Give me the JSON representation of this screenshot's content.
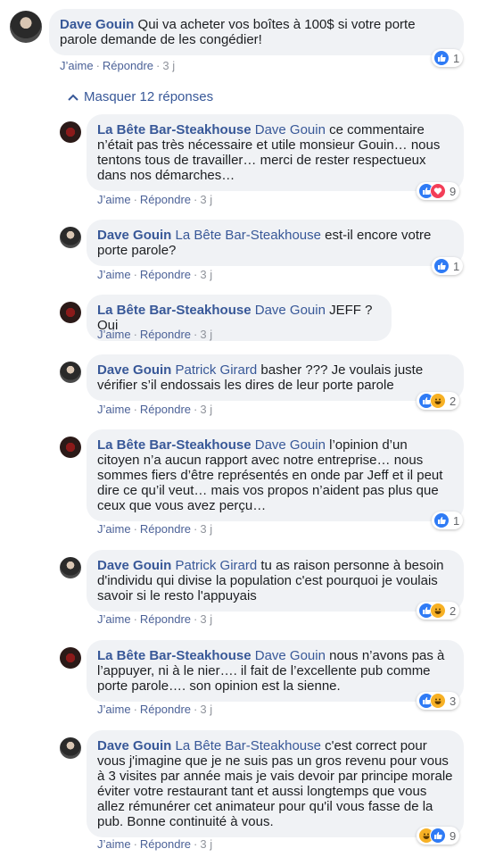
{
  "actions": {
    "like": "J’aime",
    "reply": "Répondre",
    "sep": "·"
  },
  "toggle": {
    "label": "Masquer 12 réponses"
  },
  "comments": [
    {
      "author": "Dave Gouin",
      "tag": "",
      "text": "Qui va acheter vos boîtes à 100$ si votre porte parole demande de les congédier!",
      "time": "3 j",
      "reactions": [
        "like"
      ],
      "count": "1"
    },
    {
      "author": "La Bête Bar-Steakhouse",
      "tag": "Dave Gouin",
      "text": "ce commentaire n’était pas très nécessaire et utile monsieur Gouin… nous tentons tous de travailler… merci de rester respectueux dans nos démarches…",
      "time": "3 j",
      "reactions": [
        "like",
        "love"
      ],
      "count": "9"
    },
    {
      "author": "Dave Gouin",
      "tag": "La Bête Bar-Steakhouse",
      "text": "est-il encore votre porte parole?",
      "time": "3 j",
      "reactions": [
        "like"
      ],
      "count": "1"
    },
    {
      "author": "La Bête Bar-Steakhouse",
      "tag": "Dave Gouin",
      "text": "JEFF ? Oui",
      "time": "3 j",
      "reactions": [],
      "count": ""
    },
    {
      "author": "Dave Gouin",
      "tag": "Patrick Girard",
      "text": "basher ??? Je voulais juste vérifier s’il endossais les dires de leur porte parole",
      "time": "3 j",
      "reactions": [
        "like",
        "haha"
      ],
      "count": "2"
    },
    {
      "author": "La Bête Bar-Steakhouse",
      "tag": "Dave Gouin",
      "text": "l’opinion d’un citoyen n’a aucun rapport avec notre entreprise… nous sommes fiers d’être représentés en onde par Jeff et il peut dire ce qu’il veut… mais vos propos n’aident pas plus que ceux que vous avez perçu…",
      "time": "3 j",
      "reactions": [
        "like"
      ],
      "count": "1"
    },
    {
      "author": "Dave Gouin",
      "tag": "Patrick Girard",
      "text": "tu as raison personne à besoin d'individu qui divise la population c'est pourquoi je voulais savoir si le resto l'appuyais",
      "time": "3 j",
      "reactions": [
        "like",
        "haha"
      ],
      "count": "2"
    },
    {
      "author": "La Bête Bar-Steakhouse",
      "tag": "Dave Gouin",
      "text": "nous n’avons pas à l’appuyer, ni à le nier…. il fait de l’excellente pub comme porte parole…. son opinion est la sienne.",
      "time": "3 j",
      "reactions": [
        "like",
        "haha"
      ],
      "count": "3"
    },
    {
      "author": "Dave Gouin",
      "tag": "La Bête Bar-Steakhouse",
      "text": "c'est correct pour vous j'imagine que je ne suis pas un gros revenu pour vous à 3 visites par année mais je vais devoir par principe morale éviter votre restaurant tant et aussi longtemps que vous allez rémunérer cet animateur pour qu'il vous fasse de la pub. Bonne continuité à vous.",
      "time": "3 j",
      "reactions": [
        "haha",
        "like"
      ],
      "count": "9"
    }
  ]
}
